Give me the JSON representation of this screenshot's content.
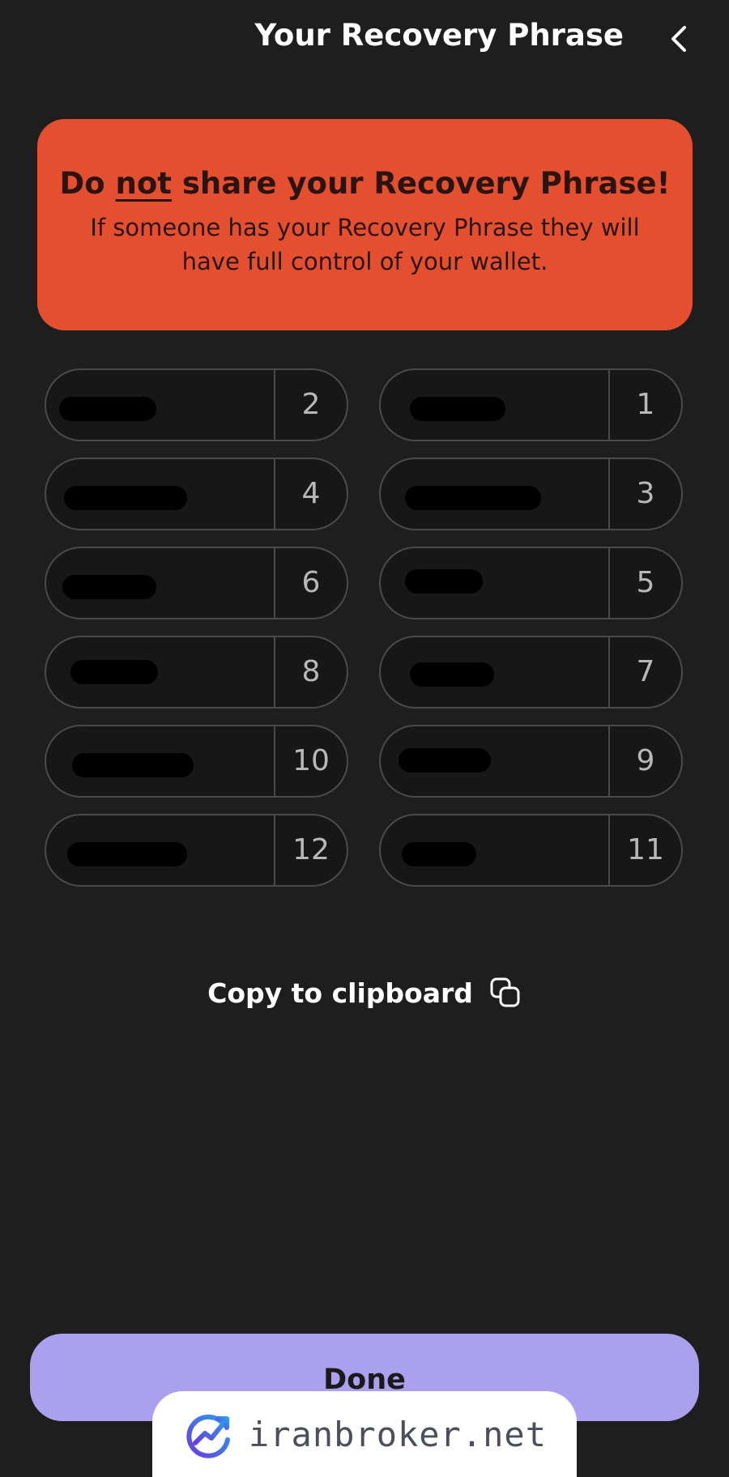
{
  "header": {
    "title": "Your Recovery Phrase",
    "back_icon": "chevron-left-icon"
  },
  "warning": {
    "title_prefix": "Do ",
    "title_emphasis": "not",
    "title_suffix": " share your Recovery Phrase!",
    "text": "If someone has your Recovery Phrase they will have full control of your wallet.",
    "color": "#e44f30"
  },
  "phrase_words": [
    {
      "number": "1"
    },
    {
      "number": "2"
    },
    {
      "number": "3"
    },
    {
      "number": "4"
    },
    {
      "number": "5"
    },
    {
      "number": "6"
    },
    {
      "number": "7"
    },
    {
      "number": "8"
    },
    {
      "number": "9"
    },
    {
      "number": "10"
    },
    {
      "number": "11"
    },
    {
      "number": "12"
    }
  ],
  "copy": {
    "label": "Copy to clipboard",
    "icon": "copy-icon"
  },
  "done": {
    "label": "Done",
    "color": "#aba0ee"
  },
  "watermark": {
    "text": "iranbroker.net"
  }
}
